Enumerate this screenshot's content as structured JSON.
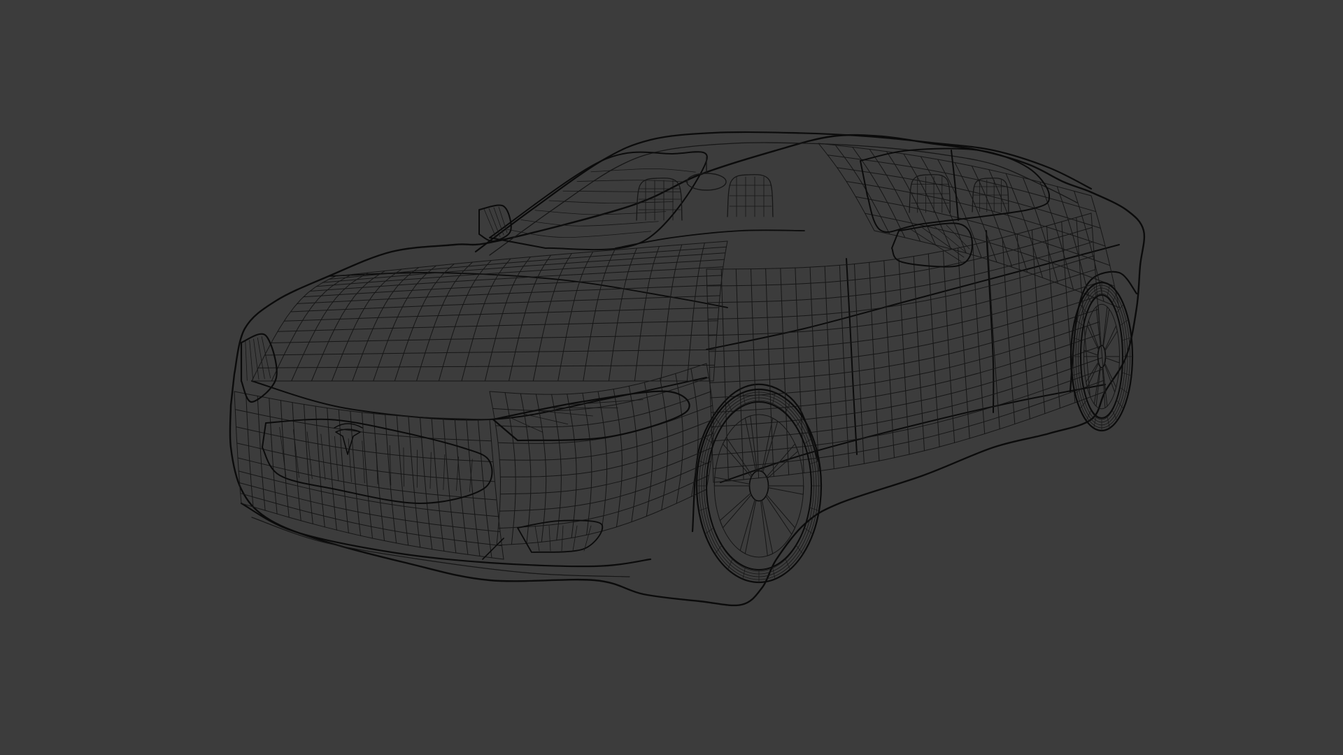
{
  "viewport": {
    "background_color": "#3c3c3c",
    "wire_color": "#161616",
    "edge_color": "#0b0b0b"
  },
  "subject": {
    "icon": "car-wireframe-icon",
    "logo_icon": "tesla-logo-icon"
  }
}
